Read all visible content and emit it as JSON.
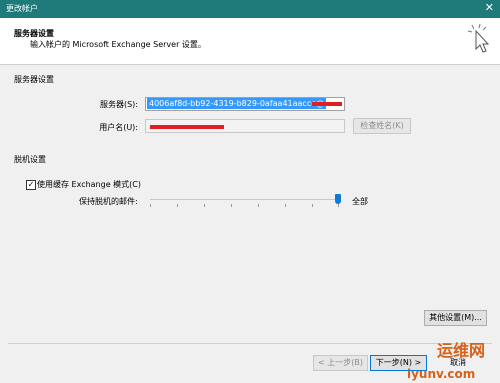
{
  "window": {
    "title": "更改帐户"
  },
  "header": {
    "title": "服务器设置",
    "subtitle": "输入帐户的 Microsoft Exchange Server 设置。"
  },
  "server_section": {
    "heading": "服务器设置",
    "server_label": "服务器(S):",
    "server_value": "4006af8d-bb92-4319-b829-0afaa41aacce@",
    "username_label": "用户名(U):",
    "check_name_button": "检查姓名(K)"
  },
  "offline_section": {
    "heading": "脱机设置",
    "cached_mode_label": "使用缓存 Exchange 模式(C)",
    "cached_mode_checked": true,
    "keep_mail_label": "保持脱机的邮件:",
    "keep_mail_value": "全部",
    "slider_fraction": 1.0
  },
  "buttons": {
    "more_settings": "其他设置(M)...",
    "back": "< 上一步(B)",
    "next": "下一步(N) >",
    "cancel": "取消"
  },
  "watermark": {
    "line1": "运维网",
    "line2": "iyunv.com"
  }
}
